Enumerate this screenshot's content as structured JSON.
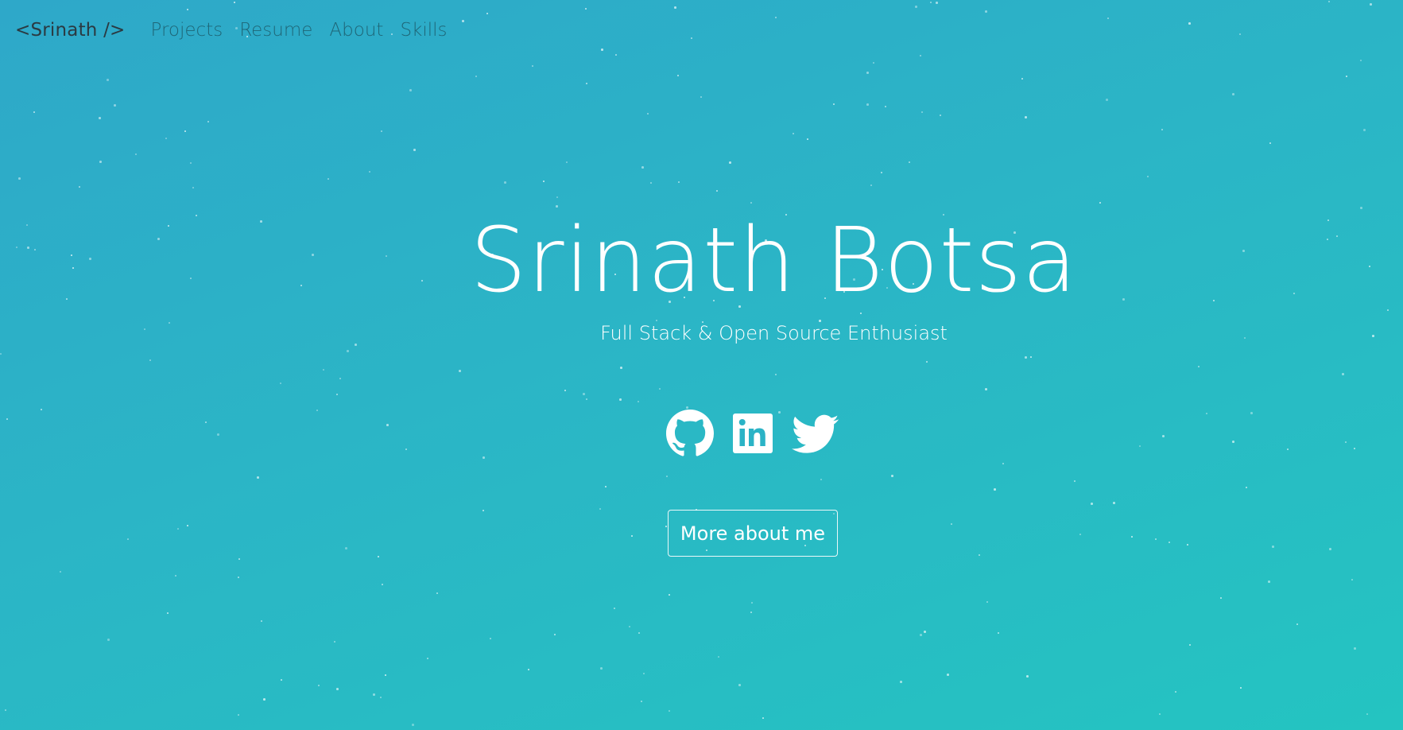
{
  "nav": {
    "brand": "<Srinath />",
    "links": [
      {
        "label": "Projects"
      },
      {
        "label": "Resume"
      },
      {
        "label": "About"
      },
      {
        "label": "Skills"
      }
    ]
  },
  "hero": {
    "title": "Srinath Botsa",
    "subtitle": "Full Stack & Open Source Enthusiast",
    "social": [
      {
        "icon": "github-icon"
      },
      {
        "icon": "linkedin-icon"
      },
      {
        "icon": "twitter-icon"
      }
    ],
    "cta_label": "More about me"
  },
  "colors": {
    "gradient_start": "#2ea8c9",
    "gradient_end": "#24c4c1",
    "brand_text": "#2b3a42",
    "nav_link": "#1f6677",
    "hero_text": "#ffffff"
  }
}
